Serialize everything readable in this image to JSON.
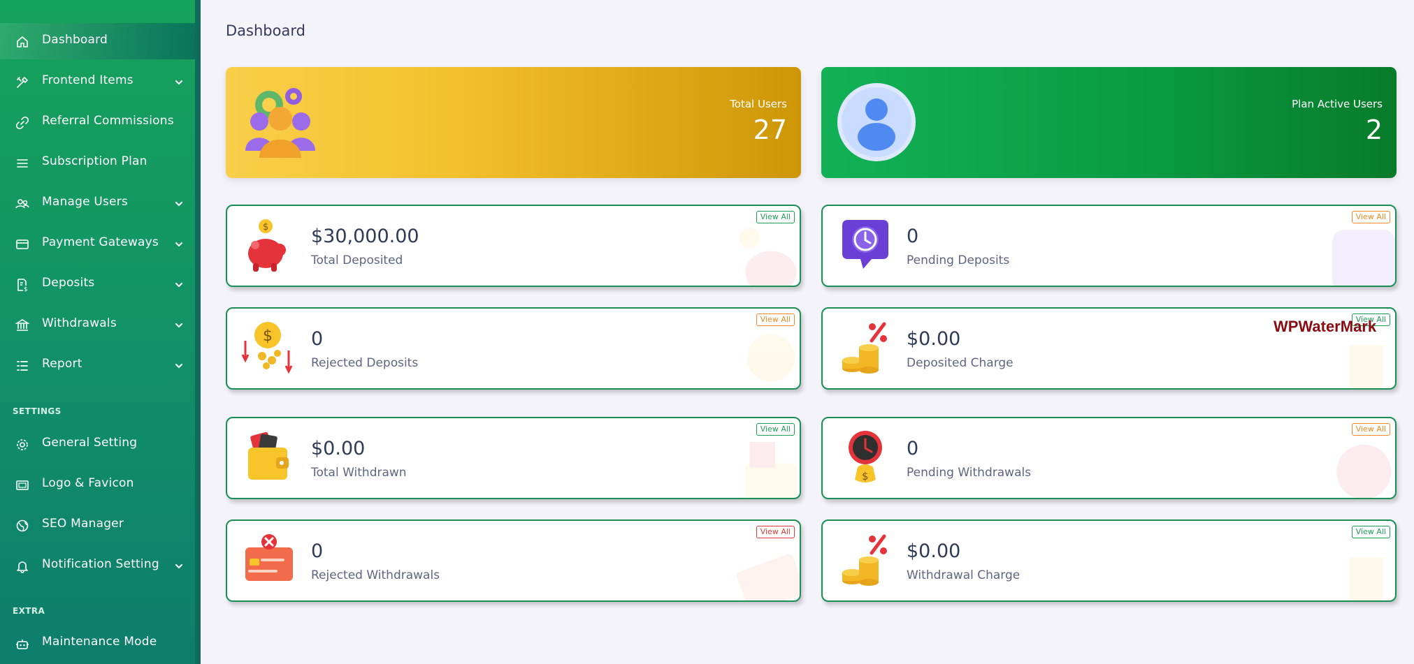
{
  "sidebar": {
    "items": [
      {
        "label": "Dashboard",
        "icon": "home-icon"
      },
      {
        "label": "Frontend Items",
        "icon": "tools-icon"
      },
      {
        "label": "Referral Commissions",
        "icon": "link-icon"
      },
      {
        "label": "Subscription Plan",
        "icon": "menu-icon"
      },
      {
        "label": "Manage Users",
        "icon": "users-icon"
      },
      {
        "label": "Payment Gateways",
        "icon": "credit-card-icon"
      },
      {
        "label": "Deposits",
        "icon": "file-dollar-icon"
      },
      {
        "label": "Withdrawals",
        "icon": "bank-icon"
      },
      {
        "label": "Report",
        "icon": "list-icon"
      }
    ],
    "settings_title": "SETTINGS",
    "settings_items": [
      {
        "label": "General Setting",
        "icon": "gear-icon"
      },
      {
        "label": "Logo & Favicon",
        "icon": "image-icon"
      },
      {
        "label": "SEO Manager",
        "icon": "globe-icon"
      },
      {
        "label": "Notification Setting",
        "icon": "bell-icon"
      }
    ],
    "extra_title": "EXTRA",
    "extra_items": [
      {
        "label": "Maintenance Mode",
        "icon": "robot-icon"
      }
    ]
  },
  "page": {
    "title": "Dashboard"
  },
  "banners": {
    "total_users": {
      "label": "Total Users",
      "value": "27"
    },
    "plan_active_users": {
      "label": "Plan Active Users",
      "value": "2"
    }
  },
  "cards": {
    "total_deposited": {
      "value": "$30,000.00",
      "label": "Total Deposited",
      "action": "View All"
    },
    "pending_deposits": {
      "value": "0",
      "label": "Pending Deposits",
      "action": "View All"
    },
    "rejected_deposits": {
      "value": "0",
      "label": "Rejected Deposits",
      "action": "View All"
    },
    "deposited_charge": {
      "value": "$0.00",
      "label": "Deposited Charge",
      "action": "View All"
    },
    "total_withdrawn": {
      "value": "$0.00",
      "label": "Total Withdrawn",
      "action": "View All"
    },
    "pending_withdrawals": {
      "value": "0",
      "label": "Pending Withdrawals",
      "action": "View All"
    },
    "rejected_withdrawals": {
      "value": "0",
      "label": "Rejected Withdrawals",
      "action": "View All"
    },
    "withdrawal_charge": {
      "value": "$0.00",
      "label": "Withdrawal Charge",
      "action": "View All"
    }
  },
  "watermark": "WPWaterMark",
  "colors": {
    "sidebar_top": "#17a25a",
    "sidebar_bottom": "#0d7d6c",
    "card_border": "#1a8f55",
    "banner_yellow": "#f2c12c",
    "banner_green": "#0a9c43",
    "view_all_green": "#1f9d55",
    "view_all_orange": "#f08a24",
    "view_all_red": "#e5383b"
  }
}
